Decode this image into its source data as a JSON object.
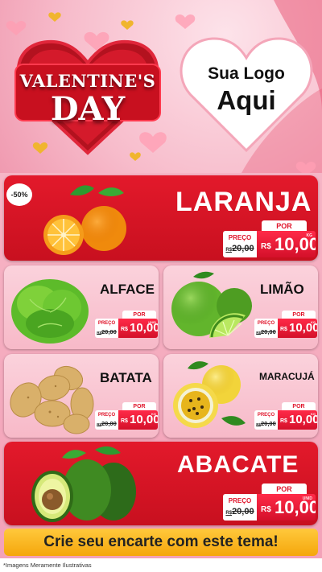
{
  "header": {
    "badge_line1": "VALENTINE'S",
    "badge_line2": "DAY",
    "logo_line1": "Sua Logo",
    "logo_line2": "Aqui"
  },
  "discount_badge": "-50%",
  "products": [
    {
      "name": "LARANJA",
      "por": "POR",
      "preco": "PREÇO",
      "old_prefix": "R$",
      "old_price": "20,00",
      "currency": "R$",
      "price": "10,00",
      "unit": "KG",
      "icon": "orange-icon"
    },
    {
      "name": "ALFACE",
      "por": "POR",
      "preco": "PREÇO",
      "old_prefix": "R$",
      "old_price": "20,00",
      "currency": "R$",
      "price": "10,00",
      "unit": "UNID",
      "icon": "lettuce-icon"
    },
    {
      "name": "LIMÃO",
      "por": "POR",
      "preco": "PREÇO",
      "old_prefix": "R$",
      "old_price": "20,00",
      "currency": "R$",
      "price": "10,00",
      "unit": "KG",
      "icon": "lime-icon"
    },
    {
      "name": "BATATA",
      "por": "POR",
      "preco": "PREÇO",
      "old_prefix": "R$",
      "old_price": "20,00",
      "currency": "R$",
      "price": "10,00",
      "unit": "KG",
      "icon": "potato-icon"
    },
    {
      "name": "MARACUJÁ",
      "por": "POR",
      "preco": "PREÇO",
      "old_prefix": "R$",
      "old_price": "20,00",
      "currency": "R$",
      "price": "10,00",
      "unit": "KG",
      "icon": "passion-fruit-icon"
    },
    {
      "name": "ABACATE",
      "por": "POR",
      "preco": "PREÇO",
      "old_prefix": "R$",
      "old_price": "20,00",
      "currency": "R$",
      "price": "10,00",
      "unit": "UNID",
      "icon": "avocado-icon"
    }
  ],
  "banner": "Crie seu encarte com este tema!",
  "footnote": "*Imagens Meramente Ilustrativas",
  "colors": {
    "red": "#e3192b",
    "pink": "#f7b9c8",
    "yellow": "#ffc93c",
    "price_red": "#e0142a"
  }
}
